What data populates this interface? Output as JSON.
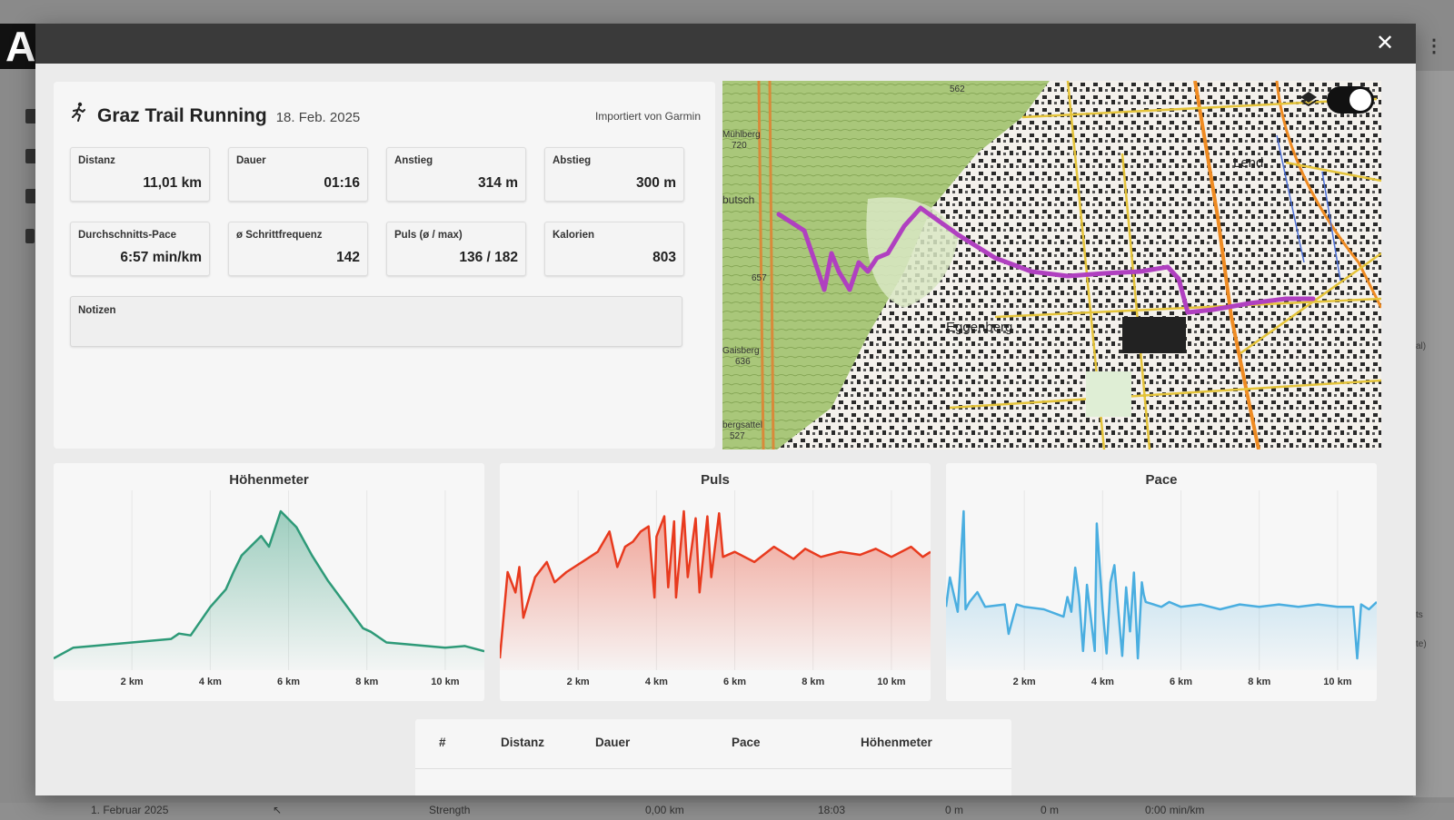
{
  "background": {
    "logo_letter": "A",
    "bottom_row": [
      "1. Februar 2025",
      "Strength",
      "0,00 km",
      "18:03",
      "0 m",
      "0 m",
      "0:00 min/km"
    ],
    "right_texts": [
      "al)",
      "ts",
      "te)"
    ]
  },
  "modal": {
    "close_label": "✕",
    "activity": {
      "title": "Graz Trail Running",
      "date": "18. Feb. 2025",
      "import_note": "Importiert von Garmin"
    },
    "stats": [
      {
        "label": "Distanz",
        "value": "11,01 km"
      },
      {
        "label": "Dauer",
        "value": "01:16"
      },
      {
        "label": "Anstieg",
        "value": "314 m"
      },
      {
        "label": "Abstieg",
        "value": "300 m"
      },
      {
        "label": "Durchschnitts-Pace",
        "value": "6:57 min/km"
      },
      {
        "label": "ø Schrittfrequenz",
        "value": "142"
      },
      {
        "label": "Puls (ø / max)",
        "value": "136 / 182"
      },
      {
        "label": "Kalorien",
        "value": "803"
      }
    ],
    "notes_label": "Notizen",
    "map": {
      "labels": [
        "Lend",
        "Eggenberg",
        "Mühlberg",
        "720",
        "Gaisberg",
        "636",
        "657",
        "562",
        "bergsattel",
        "527",
        "butsch"
      ],
      "route_color": "#b040c0"
    },
    "charts": [
      {
        "title": "Höhenmeter",
        "color": "#2e9a78",
        "x_ticks": [
          "2 km",
          "4 km",
          "6 km",
          "8 km",
          "10 km"
        ],
        "chart_data": {
          "type": "area",
          "x": [
            0,
            0.5,
            1,
            2,
            3,
            3.2,
            3.5,
            4,
            4.4,
            4.6,
            4.8,
            5.3,
            5.5,
            5.8,
            6.2,
            6.6,
            7,
            7.5,
            7.9,
            8.1,
            8.5,
            9,
            10,
            10.5,
            11
          ],
          "y": [
            2,
            14,
            16,
            20,
            24,
            30,
            28,
            60,
            80,
            100,
            118,
            140,
            128,
            168,
            150,
            118,
            90,
            60,
            36,
            32,
            20,
            18,
            14,
            16,
            10
          ],
          "xlim": [
            0,
            11
          ]
        }
      },
      {
        "title": "Puls",
        "color": "#e83a1e",
        "x_ticks": [
          "2 km",
          "4 km",
          "6 km",
          "8 km",
          "10 km"
        ],
        "chart_data": {
          "type": "area",
          "x": [
            0,
            0.2,
            0.4,
            0.5,
            0.6,
            0.9,
            1.2,
            1.4,
            1.7,
            2.1,
            2.5,
            2.8,
            3.0,
            3.2,
            3.4,
            3.6,
            3.8,
            3.95,
            4.0,
            4.2,
            4.3,
            4.45,
            4.5,
            4.7,
            4.8,
            5.0,
            5.1,
            5.3,
            5.4,
            5.6,
            5.7,
            6.0,
            6.5,
            7.0,
            7.5,
            7.8,
            8.2,
            8.7,
            9.2,
            9.6,
            10.0,
            10.5,
            10.8,
            11.0
          ],
          "y": [
            40,
            125,
            105,
            130,
            80,
            120,
            135,
            115,
            125,
            135,
            145,
            165,
            130,
            150,
            155,
            165,
            170,
            100,
            160,
            180,
            110,
            175,
            100,
            185,
            120,
            178,
            105,
            180,
            120,
            183,
            140,
            145,
            135,
            150,
            138,
            148,
            140,
            145,
            142,
            148,
            140,
            150,
            140,
            145
          ],
          "xlim": [
            0,
            11
          ]
        }
      },
      {
        "title": "Pace",
        "color": "#4aaee0",
        "x_ticks": [
          "2 km",
          "4 km",
          "6 km",
          "8 km",
          "10 km"
        ],
        "chart_data": {
          "type": "line",
          "x": [
            0,
            0.1,
            0.3,
            0.45,
            0.5,
            0.6,
            0.8,
            1.0,
            1.5,
            1.6,
            1.8,
            2.0,
            2.5,
            3.0,
            3.1,
            3.2,
            3.3,
            3.4,
            3.5,
            3.55,
            3.6,
            3.8,
            3.85,
            4.0,
            4.1,
            4.2,
            4.3,
            4.5,
            4.6,
            4.7,
            4.8,
            4.9,
            5.0,
            5.05,
            5.1,
            5.3,
            5.5,
            5.7,
            6.0,
            6.5,
            7.0,
            7.5,
            8.0,
            8.5,
            9.0,
            9.5,
            10.0,
            10.4,
            10.5,
            10.6,
            10.8,
            11.0
          ],
          "y": [
            6.6,
            7.8,
            6.4,
            10.5,
            6.5,
            6.8,
            7.2,
            6.6,
            6.7,
            5.5,
            6.7,
            6.6,
            6.5,
            6.2,
            7.0,
            6.4,
            8.2,
            7.0,
            4.8,
            6.0,
            7.5,
            4.8,
            10.0,
            6.5,
            4.7,
            7.6,
            8.3,
            4.6,
            7.4,
            5.6,
            8.0,
            4.5,
            7.6,
            7.1,
            6.8,
            6.7,
            6.6,
            6.8,
            6.6,
            6.7,
            6.5,
            6.7,
            6.6,
            6.7,
            6.6,
            6.7,
            6.6,
            6.6,
            4.5,
            6.7,
            6.5,
            6.8
          ],
          "xlim": [
            0,
            11
          ]
        }
      }
    ],
    "laps_table": {
      "headers": [
        "#",
        "Distanz",
        "Dauer",
        "Pace",
        "Höhenmeter"
      ]
    }
  }
}
